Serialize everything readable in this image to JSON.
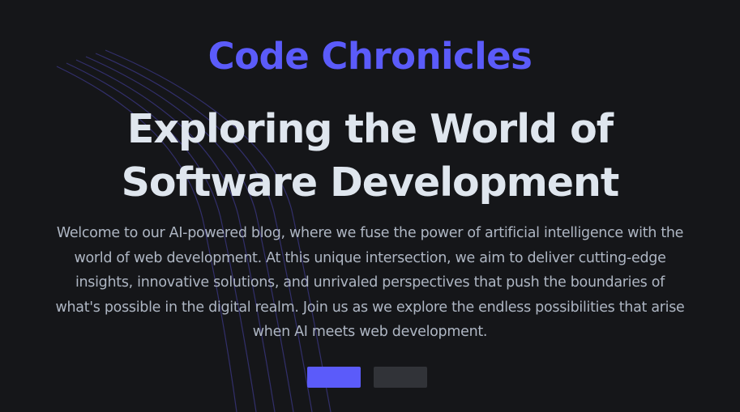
{
  "hero": {
    "brand": "Code Chronicles",
    "headline_line1": "Exploring the World of",
    "headline_line2": "Software Development",
    "intro": "Welcome to our AI-powered blog, where we fuse the power of artificial intelligence with the world of web development. At this unique intersection, we aim to deliver cutting-edge insights, innovative solutions, and unrivaled perspectives that push the boundaries of what's possible in the digital realm. Join us as we explore the endless possibilities that arise when AI meets web development."
  },
  "actions": {
    "primary_label": "",
    "secondary_label": ""
  },
  "colors": {
    "background": "#151619",
    "accent": "#5b5bfa",
    "heading": "#dfe6ee",
    "body_text": "#aeb6c3",
    "secondary_button": "#313338",
    "decorative_lines": "#3f3a8f"
  }
}
